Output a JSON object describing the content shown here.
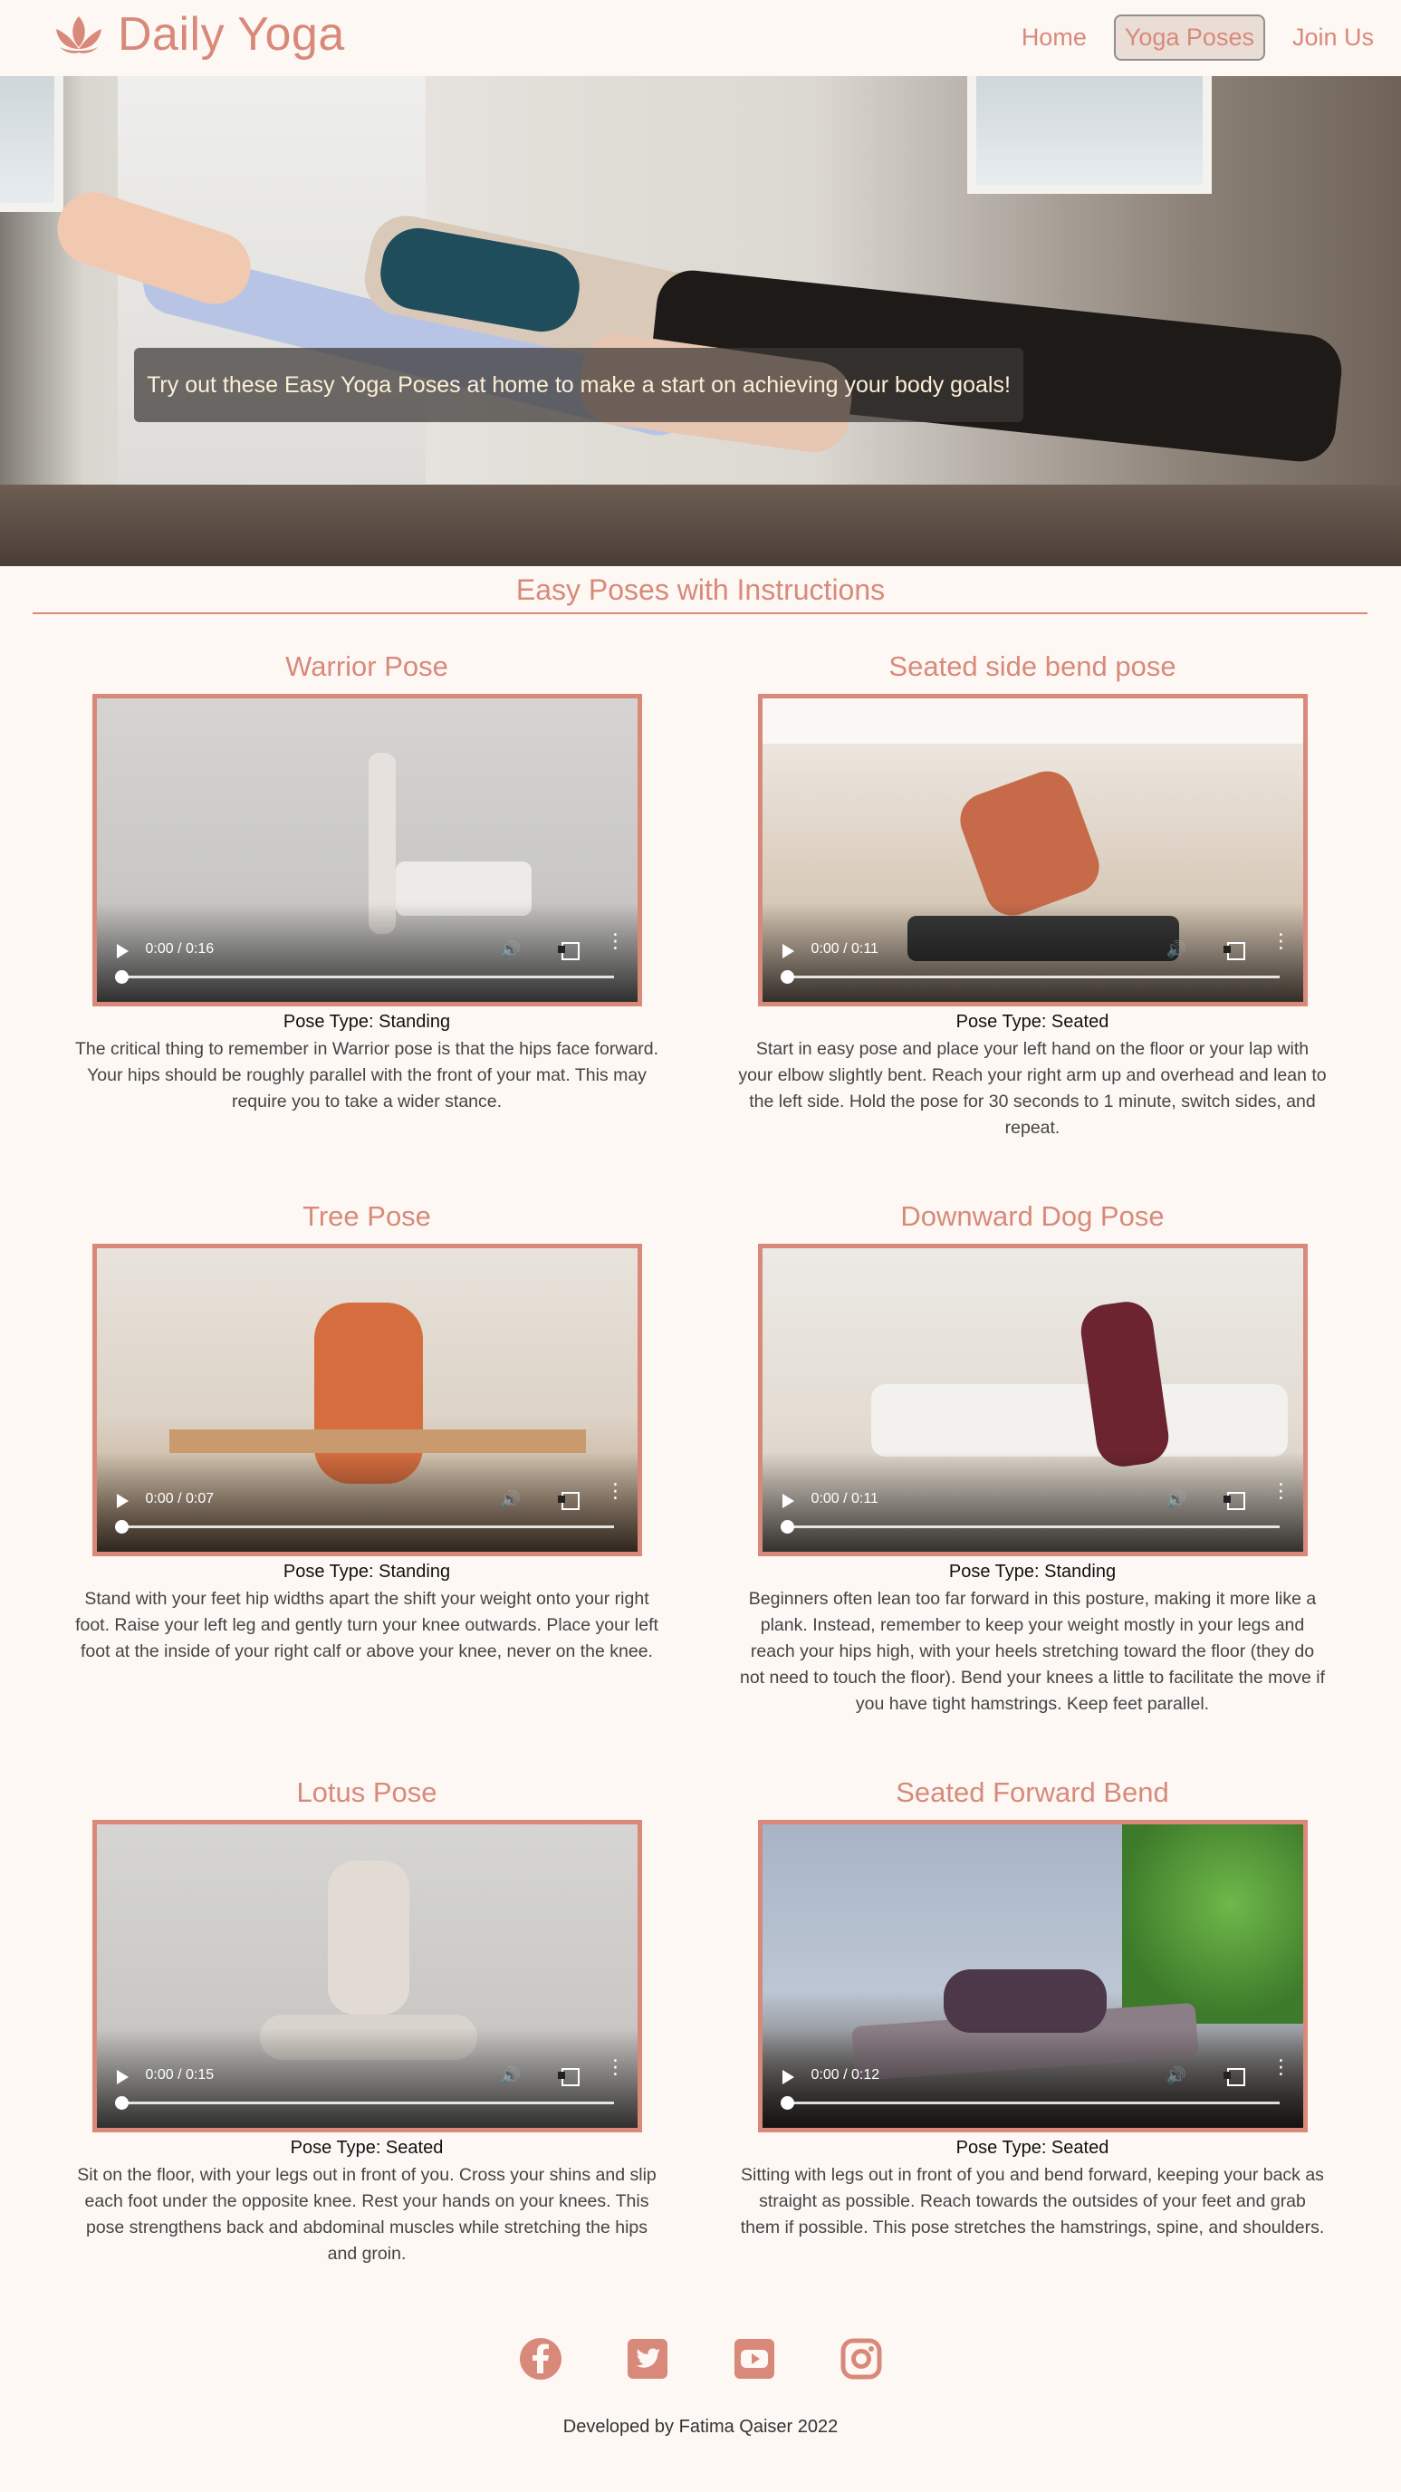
{
  "header": {
    "brand": "Daily Yoga",
    "nav": [
      "Home",
      "Yoga Poses",
      "Join Us"
    ],
    "active_nav": "Yoga Poses"
  },
  "hero": {
    "caption": "Try out these Easy Yoga Poses at home to make a start on achieving your body goals!"
  },
  "section": {
    "title": "Easy Poses with Instructions"
  },
  "poses": [
    {
      "title": "Warrior Pose",
      "time": "0:00 / 0:16",
      "type": "Pose Type: Standing",
      "description": "The critical thing to remember in Warrior pose is that the hips face forward. Your hips should be roughly parallel with the front of your mat. This may require you to take a wider stance."
    },
    {
      "title": "Seated side bend pose",
      "time": "0:00 / 0:11",
      "type": "Pose Type: Seated",
      "description": "Start in easy pose and place your left hand on the floor or your lap with your elbow slightly bent. Reach your right arm up and overhead and lean to the left side. Hold the pose for 30 seconds to 1 minute, switch sides, and repeat."
    },
    {
      "title": "Tree Pose",
      "time": "0:00 / 0:07",
      "type": "Pose Type: Standing",
      "description": "Stand with your feet hip widths apart the shift your weight onto your right foot. Raise your left leg and gently turn your knee outwards. Place your left foot at the inside of your right calf or above your knee, never on the knee."
    },
    {
      "title": "Downward Dog Pose",
      "time": "0:00 / 0:11",
      "type": "Pose Type: Standing",
      "description": "Beginners often lean too far forward in this posture, making it more like a plank. Instead, remember to keep your weight mostly in your legs and reach your hips high, with your heels stretching toward the floor (they do not need to touch the floor). Bend your knees a little to facilitate the move if you have tight hamstrings. Keep feet parallel."
    },
    {
      "title": "Lotus Pose",
      "time": "0:00 / 0:15",
      "type": "Pose Type: Seated",
      "description": "Sit on the floor, with your legs out in front of you. Cross your shins and slip each foot under the opposite knee. Rest your hands on your knees. This pose strengthens back and abdominal muscles while stretching the hips and groin."
    },
    {
      "title": "Seated Forward Bend",
      "time": "0:00 / 0:12",
      "type": "Pose Type: Seated",
      "description": "Sitting with legs out in front of you and bend forward, keeping your back as straight as possible. Reach towards the outsides of your feet and grab them if possible. This pose stretches the hamstrings, spine, and shoulders."
    }
  ],
  "footer": {
    "social": [
      "facebook-icon",
      "twitter-icon",
      "youtube-icon",
      "instagram-icon"
    ],
    "credit": "Developed by Fatima Qaiser 2022"
  },
  "colors": {
    "accent": "#d9897a",
    "background": "#fdf8f4"
  }
}
